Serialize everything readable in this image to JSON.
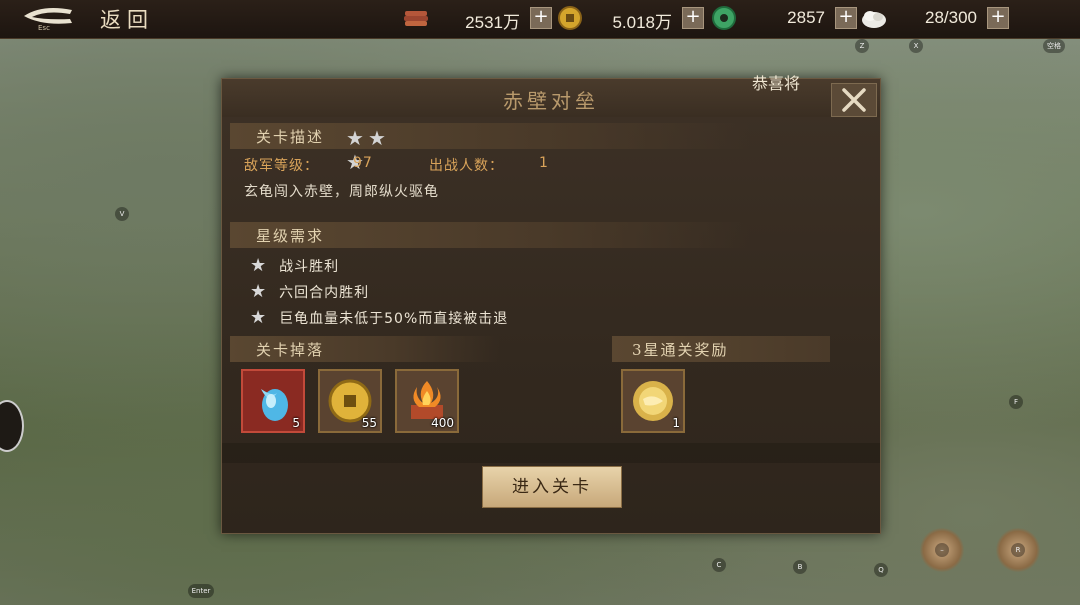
{
  "topbar": {
    "back_key": "Esc",
    "back_label": "返回",
    "resources": [
      {
        "icon": "copper-ingot-icon",
        "value": "2531万",
        "plus": "+"
      },
      {
        "icon": "gold-coin-icon",
        "value": "5.018万",
        "plus": "+"
      },
      {
        "icon": "jade-coin-icon",
        "value": "2857",
        "plus": "+"
      },
      {
        "icon": "rice-icon",
        "value": "28/300",
        "plus": "+"
      }
    ]
  },
  "key_hints": {
    "z": "Z",
    "x": "X",
    "space": "空格",
    "v": "V",
    "f": "F",
    "c": "C",
    "b": "B",
    "q": "Q",
    "r": "R",
    "enter": "Enter",
    "minus": "–"
  },
  "dialog": {
    "title": "赤壁对垒",
    "congrats": "恭喜将",
    "close_icon": "close-x-icon",
    "stage_desc_title": "关卡描述",
    "stars": [
      "★",
      "★",
      "★"
    ],
    "enemy_level_label": "敌军等级：",
    "enemy_level": "97",
    "troop_count_label": "出战人数：",
    "troop_count": "1",
    "description": "玄龟闯入赤壁，周郎纵火驱龟",
    "star_req_title": "星级需求",
    "requirements": [
      {
        "star": "★",
        "text": "战斗胜利"
      },
      {
        "star": "★",
        "text": "六回合内胜利"
      },
      {
        "star": "★",
        "text": "巨龟血量未低于50%而直接被击退"
      }
    ],
    "drops_title": "关卡掉落",
    "drops": [
      {
        "icon": "blue-crystal-icon",
        "count": "5"
      },
      {
        "icon": "gold-coin-icon",
        "count": "55"
      },
      {
        "icon": "fire-chest-icon",
        "count": "400"
      }
    ],
    "reward_title": "3星通关奖励",
    "rewards": [
      {
        "icon": "golden-orb-icon",
        "count": "1"
      }
    ],
    "enter_button": "进入关卡"
  }
}
